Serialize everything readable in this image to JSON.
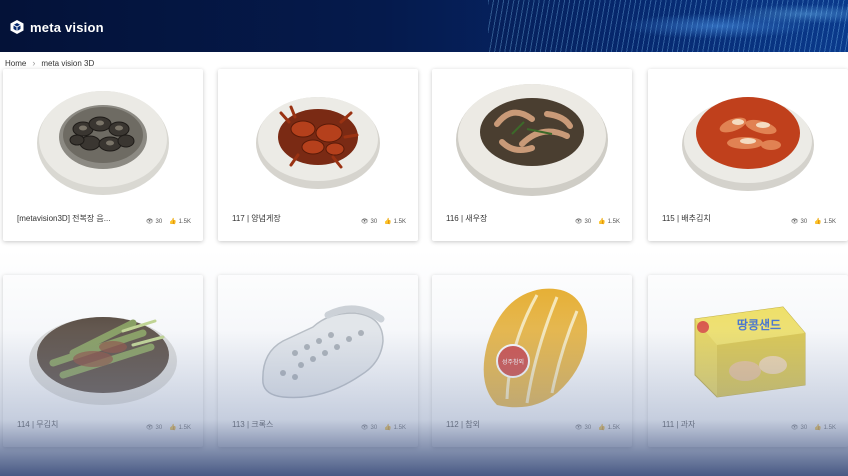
{
  "header": {
    "logo_text": "meta vision",
    "logo_icon": "cube-icon"
  },
  "breadcrumb": {
    "home": "Home",
    "current": "meta vision 3D"
  },
  "cards": [
    {
      "title": "[metavision3D] 전복장 음...",
      "views": "30",
      "likes": "1.5K",
      "subject": "abalone-bowl"
    },
    {
      "title": "117 | 양념게장",
      "views": "30",
      "likes": "1.5K",
      "subject": "crab-bowl"
    },
    {
      "title": "116 | 새우장",
      "views": "30",
      "likes": "1.5K",
      "subject": "shrimp-bowl"
    },
    {
      "title": "115 | 배추김치",
      "views": "30",
      "likes": "1.5K",
      "subject": "kimchi-bowl"
    },
    {
      "title": "114 | 무김치",
      "views": "30",
      "likes": "1.5K",
      "subject": "green-onion-kimchi"
    },
    {
      "title": "113 | 크록스",
      "views": "30",
      "likes": "1.5K",
      "subject": "crocs-shoe"
    },
    {
      "title": "112 | 참외",
      "views": "30",
      "likes": "1.5K",
      "subject": "korean-melon"
    },
    {
      "title": "111 | 과자",
      "views": "30",
      "likes": "1.5K",
      "subject": "snack-box"
    }
  ],
  "snack_box_label": "땅콩샌드",
  "melon_sticker": "성주참외"
}
